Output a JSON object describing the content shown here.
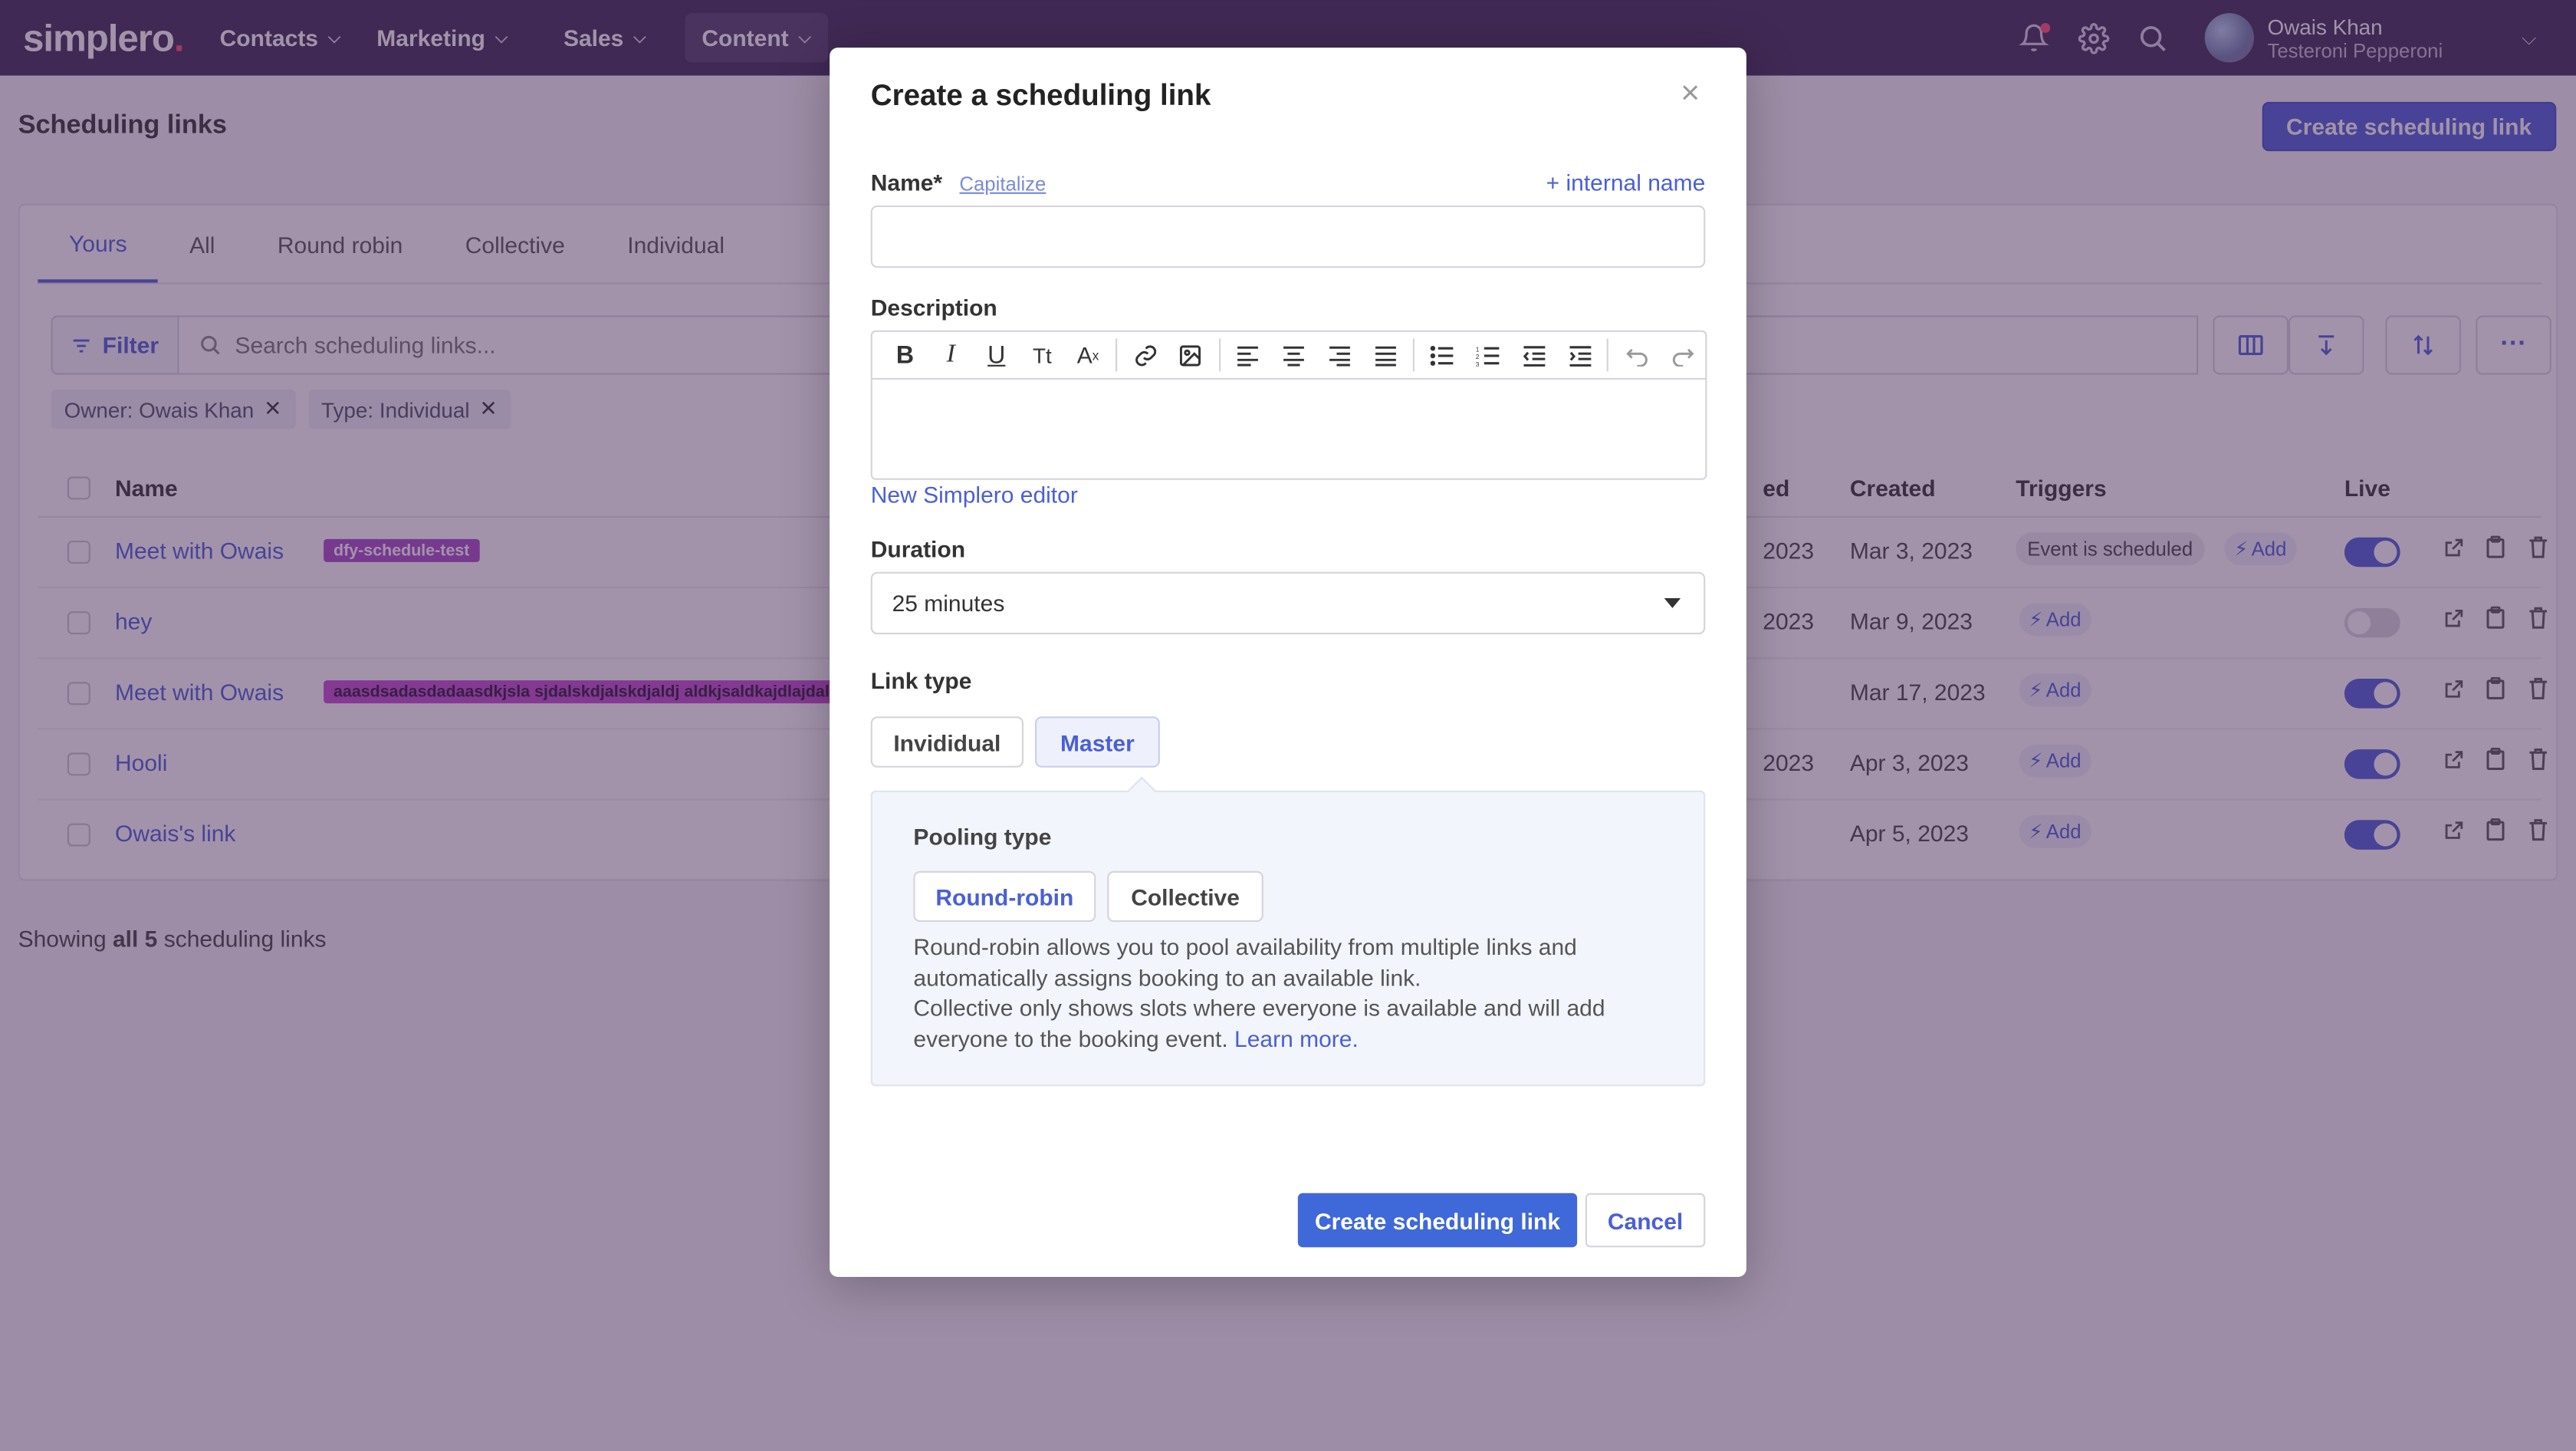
{
  "nav": {
    "logo": "simplero",
    "logo_dot": ".",
    "items": [
      {
        "label": "Contacts"
      },
      {
        "label": "Marketing"
      },
      {
        "label": "Sales"
      },
      {
        "label": "Content"
      }
    ],
    "user_name": "Owais Khan",
    "user_sub": "Testeroni Pepperoni"
  },
  "page": {
    "title": "Scheduling links",
    "create_button": "Create scheduling link"
  },
  "tabs": [
    {
      "label": "Yours"
    },
    {
      "label": "All"
    },
    {
      "label": "Round robin"
    },
    {
      "label": "Collective"
    },
    {
      "label": "Individual"
    }
  ],
  "toolbar": {
    "filter_label": "Filter",
    "search_placeholder": "Search scheduling links...",
    "more_label": "···"
  },
  "chips": [
    {
      "label": "Owner: Owais Khan"
    },
    {
      "label": "Type: Individual"
    }
  ],
  "table": {
    "headers": {
      "name": "Name",
      "updated": "ed",
      "created": "Created",
      "triggers": "Triggers",
      "live": "Live"
    },
    "rows": [
      {
        "name": "Meet with Owais",
        "tag": "dfy-schedule-test",
        "updated": "2023",
        "created": "Mar 3, 2023",
        "trigger": "Event is scheduled",
        "add": "Add",
        "live": true
      },
      {
        "name": "hey",
        "tag": "",
        "updated": "2023",
        "created": "Mar 9, 2023",
        "trigger": "",
        "add": "Add",
        "live": false
      },
      {
        "name": "Meet with Owais",
        "tag": "aaasdsadasdadaasdkjsla sjdalskdjalskdjaldj aldkjsaldkajdlajdalsk",
        "updated": "",
        "created": "Mar 17, 2023",
        "trigger": "",
        "add": "Add",
        "live": true
      },
      {
        "name": "Hooli",
        "tag": "",
        "updated": "2023",
        "created": "Apr 3, 2023",
        "trigger": "",
        "add": "Add",
        "live": true
      },
      {
        "name": "Owais's link",
        "tag": "",
        "updated": "",
        "created": "Apr 5, 2023",
        "trigger": "",
        "add": "Add",
        "live": true
      }
    ]
  },
  "showing": {
    "prefix": "Showing ",
    "bold": "all 5",
    "suffix": " scheduling links"
  },
  "modal": {
    "title": "Create a scheduling link",
    "close": "×",
    "name_label": "Name*",
    "capitalize": "Capitalize",
    "internal_name": "+ internal name",
    "name_value": "",
    "description_label": "Description",
    "editor_link": "New Simplero editor",
    "duration_label": "Duration",
    "duration_value": "25 minutes",
    "link_type_label": "Link type",
    "link_types": [
      {
        "label": "Invididual"
      },
      {
        "label": "Master"
      }
    ],
    "link_type_selected": "Master",
    "pooling_label": "Pooling type",
    "pooling_types": [
      {
        "label": "Round-robin"
      },
      {
        "label": "Collective"
      }
    ],
    "pooling_desc_1": "Round-robin allows you to pool availability from multiple links and automatically assigns booking to an available link.",
    "pooling_desc_2": "Collective only shows slots where everyone is available and will add everyone to the booking event.",
    "learn_more": "Learn more.",
    "submit": "Create scheduling link",
    "cancel": "Cancel"
  },
  "colors": {
    "nav_bg": "#3b2a52",
    "accent": "#4a5fd6",
    "primary_button": "#3f68d8",
    "overlay": "rgba(70,40,85,0.5)",
    "tag_purple": "#a74ac9"
  }
}
